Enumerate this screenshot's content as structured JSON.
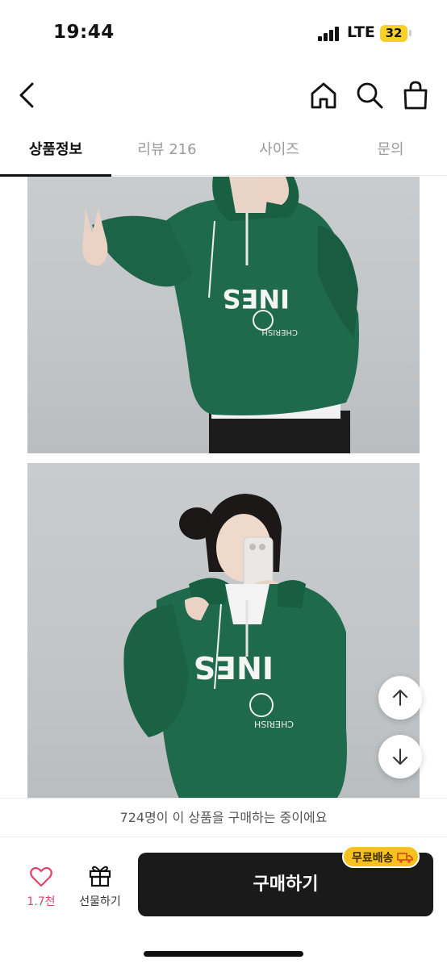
{
  "status_bar": {
    "time": "19:44",
    "network": "LTE",
    "battery": "32"
  },
  "header": {
    "back_icon": "chevron-left-icon",
    "home_icon": "home-icon",
    "search_icon": "search-icon",
    "cart_icon": "shopping-bag-icon"
  },
  "tabs": [
    {
      "label": "상품정보",
      "active": true
    },
    {
      "label": "리뷰 216",
      "active": false
    },
    {
      "label": "사이즈",
      "active": false
    },
    {
      "label": "문의",
      "active": false
    }
  ],
  "scroll_controls": {
    "up_icon": "arrow-up-icon",
    "down_icon": "arrow-down-icon"
  },
  "banner": {
    "text": "724명이 이 상품을 구매하는 중이에요"
  },
  "bottom_bar": {
    "like_count": "1.7천",
    "gift_label": "선물하기",
    "buy_label": "구매하기",
    "free_shipping_badge": "무료배송",
    "colors": {
      "like": "#e0446b",
      "buy_button": "#1a1a1a",
      "badge": "#f7c21b"
    }
  }
}
